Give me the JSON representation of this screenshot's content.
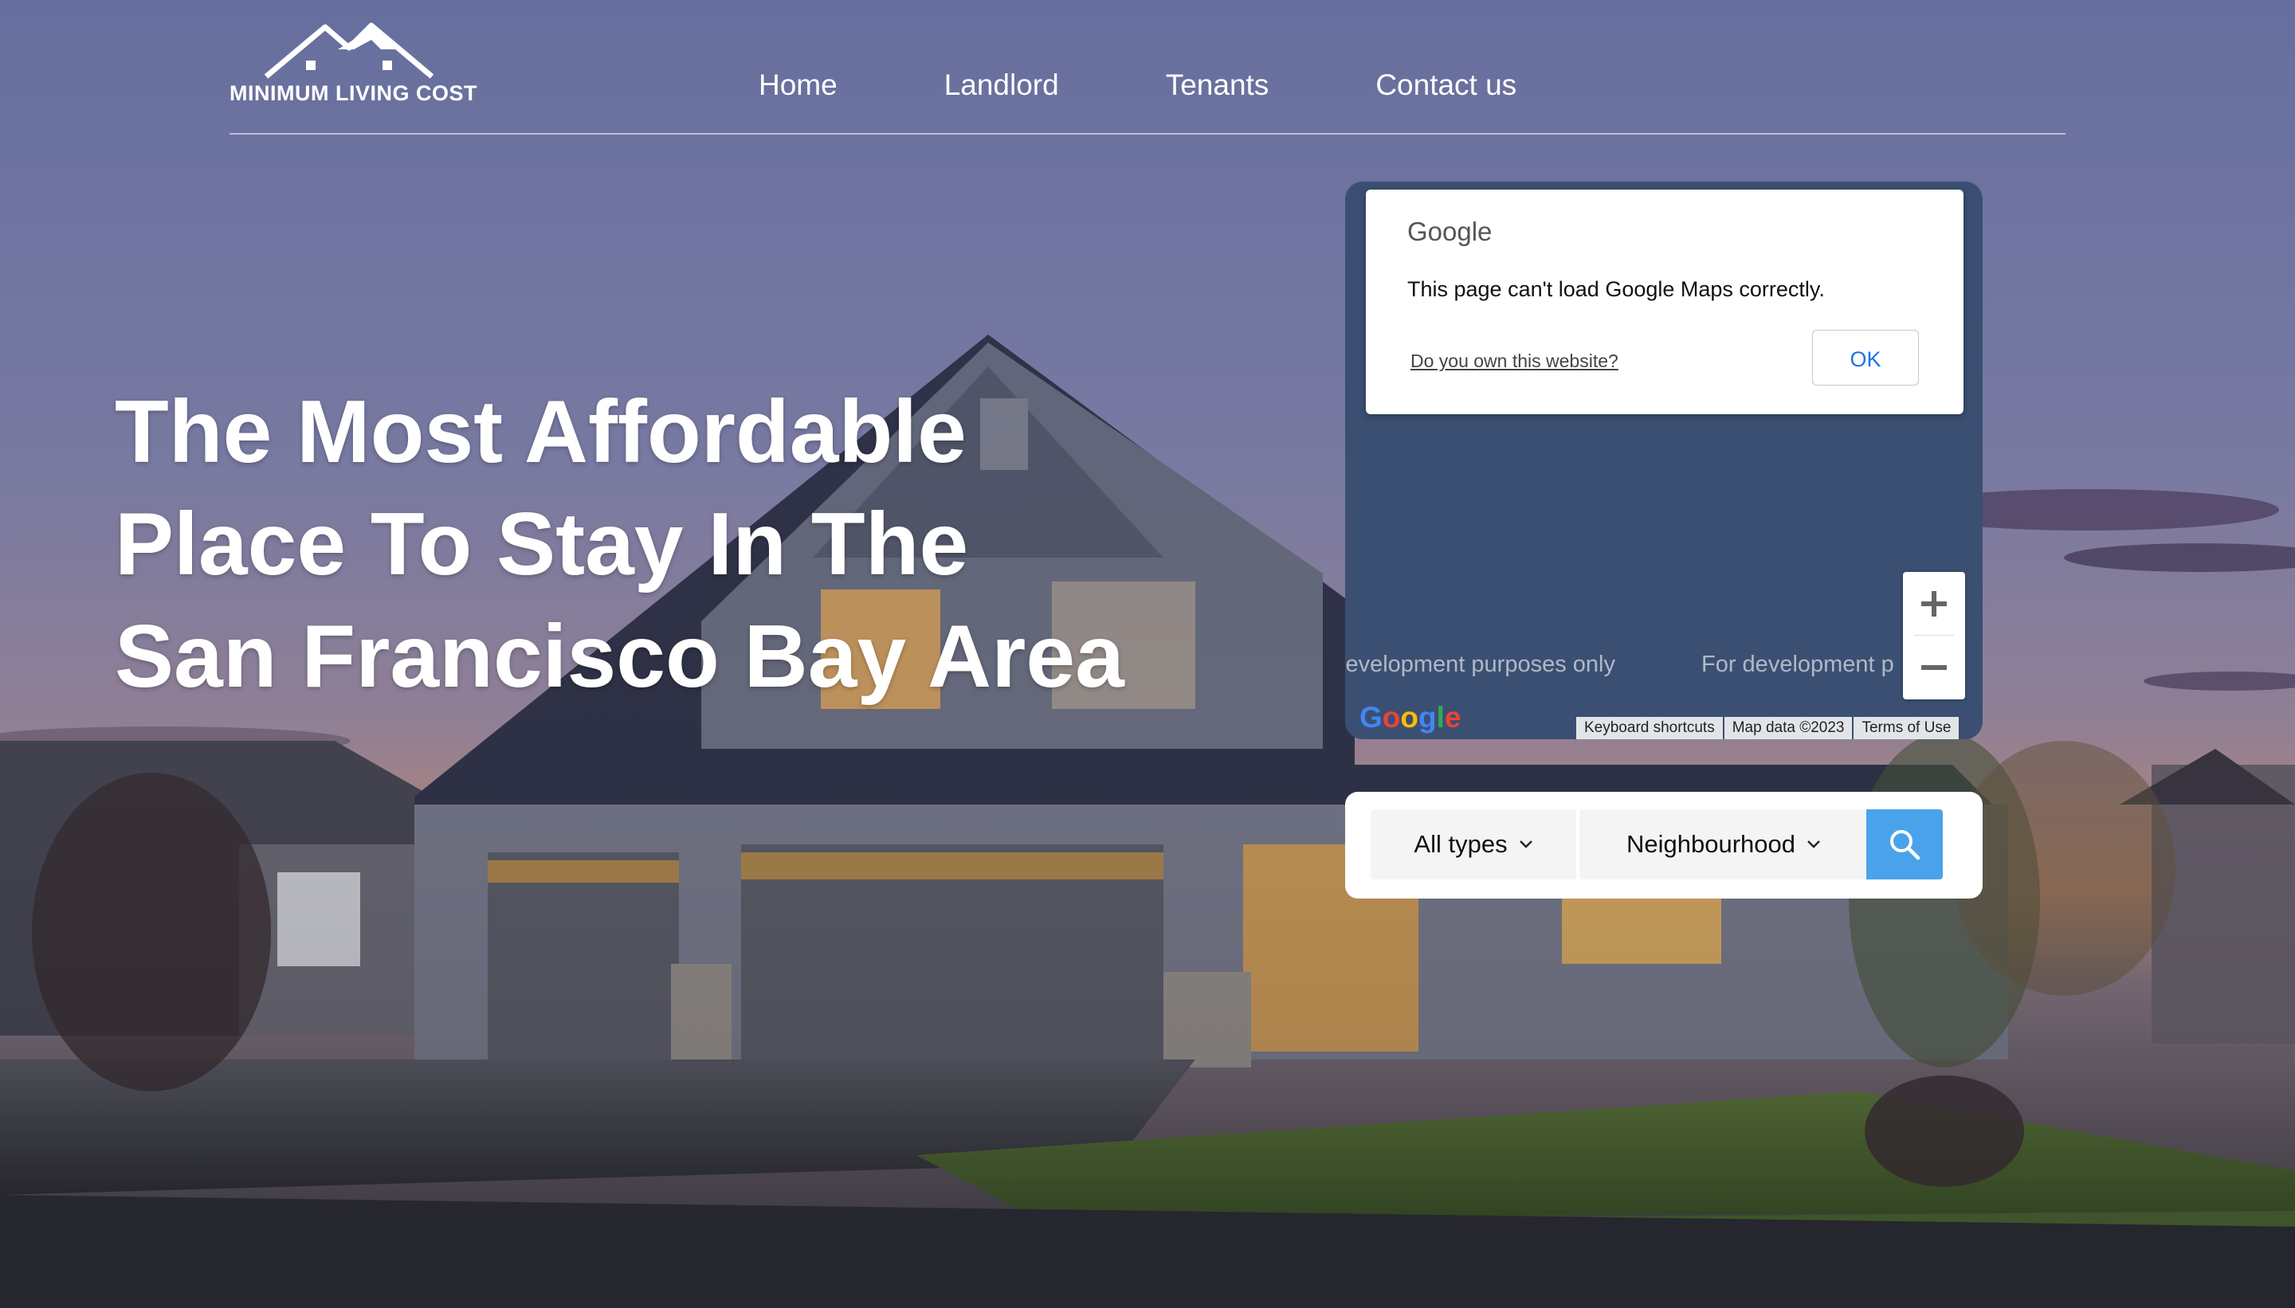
{
  "brand": {
    "logo_text": "MINIMUM LIVING COST"
  },
  "nav": {
    "items": [
      {
        "label": "Home"
      },
      {
        "label": "Landlord"
      },
      {
        "label": "Tenants"
      },
      {
        "label": "Contact us"
      }
    ]
  },
  "hero": {
    "title": "The Most Affordable Place To Stay In The San Francisco Bay Area"
  },
  "map": {
    "dialog_brand": "Google",
    "error_message": "This page can't load Google Maps correctly.",
    "own_site_link": "Do you own this website?",
    "ok_label": "OK",
    "watermark": "For development purposes only",
    "watermark_left": "levelopment purposes only",
    "watermark_right": "For development p",
    "google_logo": "Google",
    "footer": {
      "shortcuts": "Keyboard shortcuts",
      "map_data": "Map data ©2023",
      "terms": "Terms of Use"
    },
    "zoom_in_icon": "plus-icon",
    "zoom_out_icon": "minus-icon"
  },
  "search": {
    "type_label": "All types",
    "neighbourhood_label": "Neighbourhood",
    "button_icon": "search-icon",
    "button_color": "#4aa3ea"
  },
  "colors": {
    "map_background": "#3b4f72",
    "sky_top": "#7f88b8",
    "sky_horizon": "#e8a27a"
  }
}
